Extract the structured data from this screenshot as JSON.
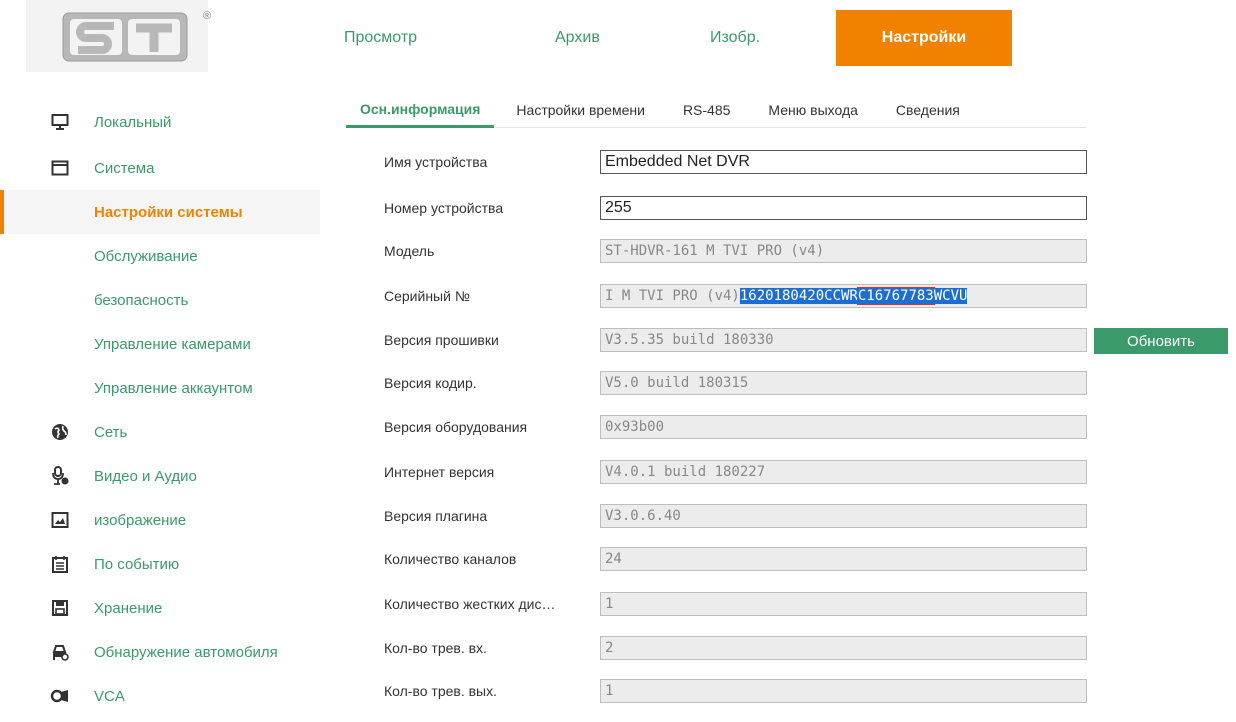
{
  "header": {
    "logo_text": "ST",
    "reg_mark": "®",
    "tabs": [
      {
        "label": "Просмотр"
      },
      {
        "label": "Архив"
      },
      {
        "label": "Изобр."
      },
      {
        "label": "Настройки",
        "active": true
      }
    ]
  },
  "sidebar": {
    "items": [
      {
        "label": "Локальный",
        "icon": "monitor-icon"
      },
      {
        "label": "Система",
        "icon": "window-icon"
      },
      {
        "label": "Настройки системы",
        "active": true
      },
      {
        "label": "Обслуживание"
      },
      {
        "label": "безопасность"
      },
      {
        "label": "Управление камерами"
      },
      {
        "label": "Управление аккаунтом"
      },
      {
        "label": "Сеть",
        "icon": "globe-icon"
      },
      {
        "label": "Видео и Аудио",
        "icon": "audio-video-icon"
      },
      {
        "label": "изображение",
        "icon": "image-icon"
      },
      {
        "label": "По событию",
        "icon": "calendar-icon"
      },
      {
        "label": "Хранение",
        "icon": "save-icon"
      },
      {
        "label": "Обнаружение автомобиля",
        "icon": "car-icon"
      },
      {
        "label": "VCA",
        "icon": "vca-icon"
      }
    ]
  },
  "subtabs": [
    {
      "label": "Осн.информация",
      "active": true
    },
    {
      "label": "Настройки времени"
    },
    {
      "label": "RS-485"
    },
    {
      "label": "Меню выхода"
    },
    {
      "label": "Сведения"
    }
  ],
  "form": {
    "device_name": {
      "label": "Имя устройства",
      "value": "Embedded Net DVR"
    },
    "device_number": {
      "label": "Номер устройства",
      "value": "255"
    },
    "model": {
      "label": "Модель",
      "value": "ST-HDVR-161 M TVI PRO (v4)"
    },
    "serial": {
      "label": "Серийный №",
      "value_prefix": "I M TVI PRO (v4)",
      "value_sel_1": "1620180420CCWR",
      "value_sel_boxed": "C16767783",
      "value_sel_2": "WCVU"
    },
    "firmware": {
      "label": "Версия прошивки",
      "value": "V3.5.35 build 180330"
    },
    "encoding": {
      "label": "Версия кодир.",
      "value": "V5.0 build 180315"
    },
    "hardware": {
      "label": "Версия оборудования",
      "value": "0x93b00"
    },
    "web": {
      "label": "Интернет версия",
      "value": "V4.0.1 build 180227"
    },
    "plugin": {
      "label": "Версия плагина",
      "value": "V3.0.6.40"
    },
    "channels": {
      "label": "Количество каналов",
      "value": "24"
    },
    "hdd": {
      "label": "Количество жестких дис…",
      "value": "1"
    },
    "alarm_in": {
      "label": "Кол-во трев. вх.",
      "value": "2"
    },
    "alarm_out": {
      "label": "Кол-во трев. вых.",
      "value": "1"
    },
    "update_button": "Обновить"
  },
  "colors": {
    "accent_orange": "#f08200",
    "accent_green": "#3a9a6a",
    "selection_blue": "#1c6fd0"
  }
}
